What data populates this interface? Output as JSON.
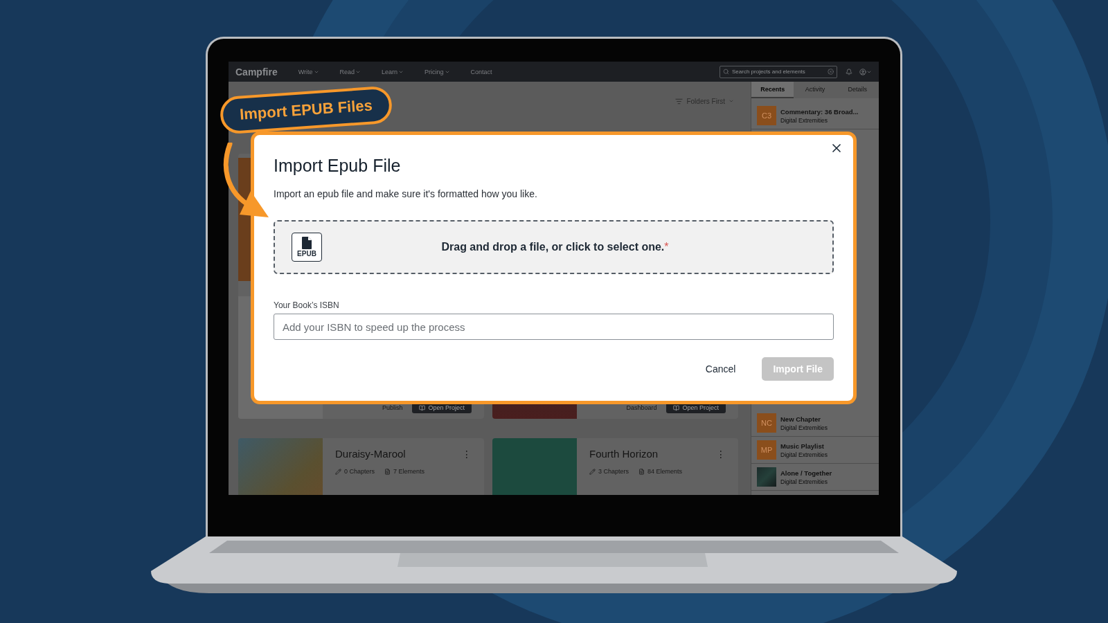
{
  "nav": {
    "logo": "Campfire",
    "items": [
      {
        "label": "Write",
        "dropdown": true
      },
      {
        "label": "Read",
        "dropdown": true
      },
      {
        "label": "Learn",
        "dropdown": true
      },
      {
        "label": "Pricing",
        "dropdown": true
      },
      {
        "label": "Contact",
        "dropdown": false
      }
    ],
    "search": {
      "placeholder": "Search projects and elements"
    }
  },
  "toolbar": {
    "sort": "Folders First"
  },
  "sidebar": {
    "tabs": [
      {
        "label": "Recents",
        "selected": true
      },
      {
        "label": "Activity",
        "selected": false
      },
      {
        "label": "Details",
        "selected": false
      }
    ],
    "items": [
      {
        "kind": "badge",
        "badge": "C3",
        "title": "Commentary: 36 Broad...",
        "subtitle": "Digital Extremities"
      },
      {
        "kind": "badge",
        "badge": "NC",
        "title": "New Chapter",
        "subtitle": "Digital Extremities"
      },
      {
        "kind": "badge",
        "badge": "MP",
        "title": "Music Playlist",
        "subtitle": "Digital Extremities"
      },
      {
        "kind": "cover",
        "title": "Alone / Together",
        "subtitle": "Digital Extremities"
      }
    ]
  },
  "project_footers": [
    {
      "link": "Publish",
      "action": "Open Project"
    },
    {
      "link": "Dashboard",
      "action": "Open Project"
    }
  ],
  "projects": [
    {
      "title": "Duraisy-Marool",
      "menu_icon": "⋮",
      "chapters": "0 Chapters",
      "elements": "7 Elements"
    },
    {
      "title": "Fourth Horizon",
      "menu_icon": "⋮",
      "chapters": "3 Chapters",
      "elements": "84 Elements"
    }
  ],
  "callout": {
    "text": "Import EPUB Files"
  },
  "modal": {
    "title": "Import Epub File",
    "description": "Import an epub file and make sure it's formatted how you like.",
    "dropzone": {
      "badge": "EPUB",
      "text": "Drag and drop a file, or click to select one.",
      "required_mark": "*"
    },
    "isbn": {
      "label": "Your Book’s ISBN",
      "placeholder": "Add your ISBN to speed up the process"
    },
    "buttons": [
      {
        "label": "Cancel",
        "kind": "text",
        "disabled": false
      },
      {
        "label": "Import File",
        "kind": "primary",
        "disabled": true
      }
    ]
  }
}
